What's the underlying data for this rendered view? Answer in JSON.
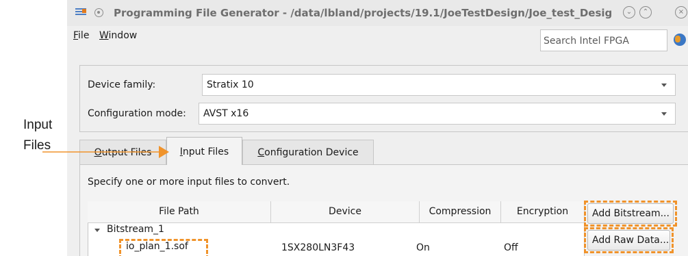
{
  "callout": {
    "label_line1": "Input",
    "label_line2": "Files"
  },
  "titlebar": {
    "title": "Programming File Generator - /data/lbland/projects/19.1/JoeTestDesign/Joe_test_Desig"
  },
  "menubar": {
    "file": {
      "mnemonic": "F",
      "rest": "ile"
    },
    "window": {
      "mnemonic": "W",
      "rest": "indow"
    }
  },
  "search": {
    "placeholder": "Search Intel FPGA"
  },
  "form": {
    "device_family_label": "Device family:",
    "device_family_value": "Stratix 10",
    "config_mode_label": "Configuration mode:",
    "config_mode_value": "AVST x16"
  },
  "tabs": {
    "output": {
      "mnemonic": "O",
      "rest": "utput Files"
    },
    "input": {
      "mnemonic": "I",
      "rest": "nput Files"
    },
    "config": {
      "mnemonic": "C",
      "rest": "onfiguration Device"
    }
  },
  "hint": "Specify one or more input files to convert.",
  "table": {
    "columns": [
      "File Path",
      "Device",
      "Compression",
      "Encryption"
    ],
    "group": "Bitstream_1",
    "rows": [
      {
        "path": "io_plan_1.sof",
        "device": "1SX280LN3F43",
        "compression": "On",
        "encryption": "Off"
      }
    ]
  },
  "buttons": {
    "add_bitstream": "Add Bitstream...",
    "add_raw_data": "Add Raw Data..."
  },
  "colors": {
    "highlight": "#f0932b",
    "accent": "#3b77c4"
  }
}
